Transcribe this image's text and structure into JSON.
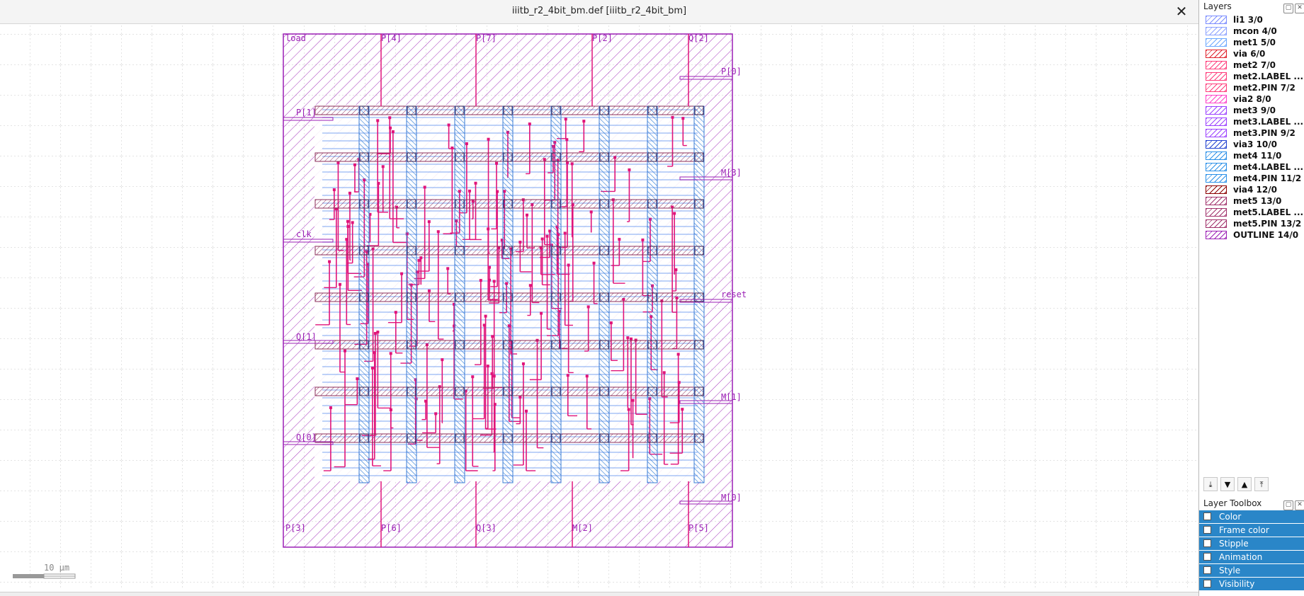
{
  "window": {
    "title": "iiitb_r2_4bit_bm.def [iiitb_r2_4bit_bm]",
    "close_icon": "close-icon"
  },
  "canvas": {
    "grid_color": "#c8c8c8",
    "outline_color": "#9b1fb5",
    "met4_color": "#3a7bd5",
    "met5_color": "#8b2d5a",
    "met2_color": "#e0147a",
    "pin_text_color": "#9b1fb5",
    "pins": [
      {
        "name": "load"
      },
      {
        "name": "P[4]"
      },
      {
        "name": "P[7]"
      },
      {
        "name": "P[2]"
      },
      {
        "name": "Q[2]"
      },
      {
        "name": "P[0]"
      },
      {
        "name": "P[1]"
      },
      {
        "name": "M[3]"
      },
      {
        "name": "clk"
      },
      {
        "name": "reset"
      },
      {
        "name": "Q[1]"
      },
      {
        "name": "M[1]"
      },
      {
        "name": "Q[0]"
      },
      {
        "name": "M[0]"
      },
      {
        "name": "P[3]"
      },
      {
        "name": "P[6]"
      },
      {
        "name": "Q[3]"
      },
      {
        "name": "M[2]"
      },
      {
        "name": "P[5]"
      }
    ],
    "scale_label": "10 µm"
  },
  "layers_panel": {
    "title": "Layers",
    "layers": [
      {
        "name": "li1 3/0",
        "color": "#7a8cff"
      },
      {
        "name": "mcon 4/0",
        "color": "#8aa0ff"
      },
      {
        "name": "met1 5/0",
        "color": "#6aa8ff"
      },
      {
        "name": "via 6/0",
        "color": "#e0202a"
      },
      {
        "name": "met2 7/0",
        "color": "#ff3b7a"
      },
      {
        "name": "met2.LABEL ...",
        "color": "#ff3b7a"
      },
      {
        "name": "met2.PIN 7/2",
        "color": "#ff3b7a"
      },
      {
        "name": "via2 8/0",
        "color": "#ff40c8"
      },
      {
        "name": "met3 9/0",
        "color": "#9b40ff"
      },
      {
        "name": "met3.LABEL ...",
        "color": "#9b40ff"
      },
      {
        "name": "met3.PIN 9/2",
        "color": "#9b40ff"
      },
      {
        "name": "via3 10/0",
        "color": "#2040d0"
      },
      {
        "name": "met4 11/0",
        "color": "#2a90e8"
      },
      {
        "name": "met4.LABEL ...",
        "color": "#2a90e8"
      },
      {
        "name": "met4.PIN 11/2",
        "color": "#2a90e8"
      },
      {
        "name": "via4 12/0",
        "color": "#8b0000"
      },
      {
        "name": "met5 13/0",
        "color": "#a0306a"
      },
      {
        "name": "met5.LABEL ...",
        "color": "#a0306a"
      },
      {
        "name": "met5.PIN 13/2",
        "color": "#a0306a"
      },
      {
        "name": "OUTLINE 14/0",
        "color": "#9b1fb5"
      }
    ],
    "toolbar_icons": [
      "move-to-bottom-icon",
      "move-down-icon",
      "move-up-icon",
      "move-to-top-icon"
    ]
  },
  "toolbox": {
    "title": "Layer Toolbox",
    "items": [
      {
        "label": "Color"
      },
      {
        "label": "Frame color"
      },
      {
        "label": "Stipple"
      },
      {
        "label": "Animation"
      },
      {
        "label": "Style"
      },
      {
        "label": "Visibility"
      }
    ]
  }
}
